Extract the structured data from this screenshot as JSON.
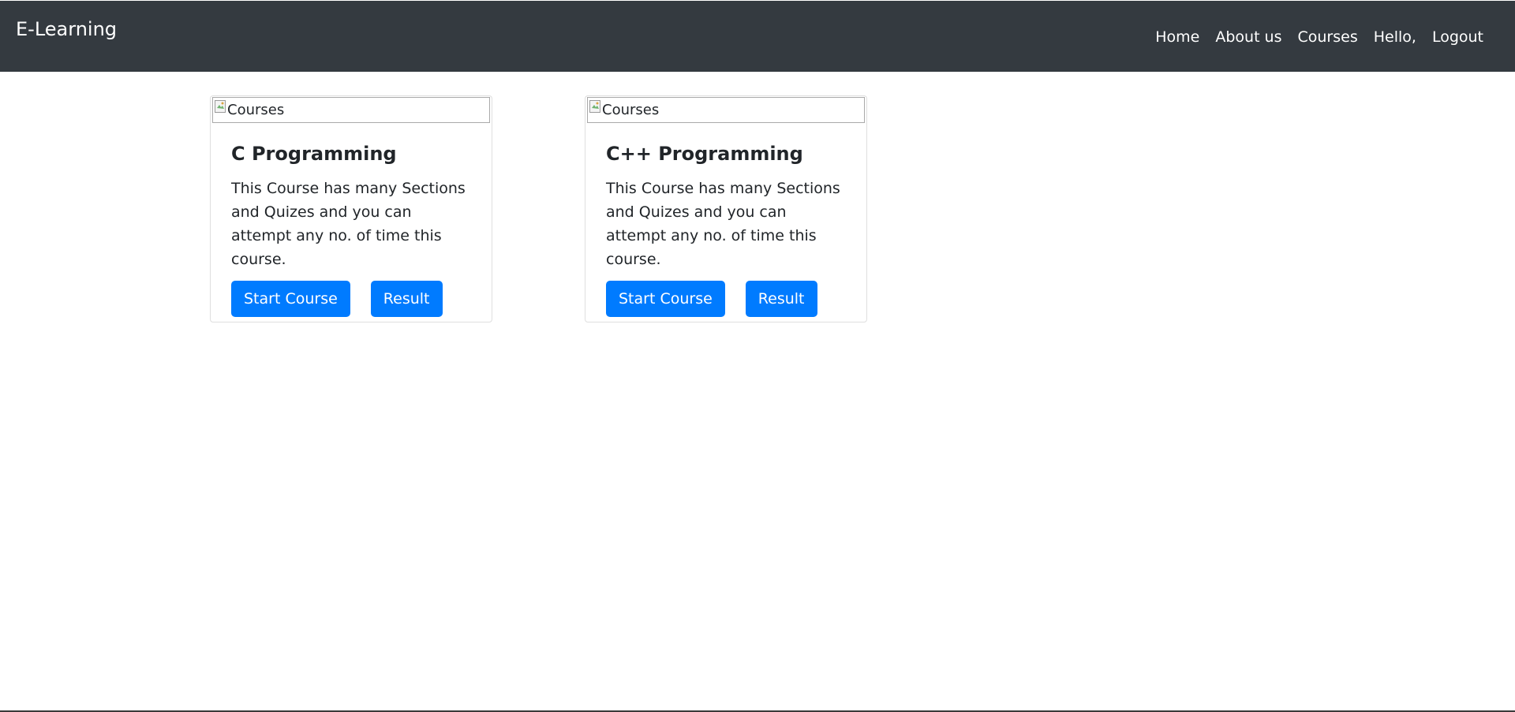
{
  "navbar": {
    "brand": "E-Learning",
    "links": [
      "Home",
      "About us",
      "Courses",
      "Hello,",
      "Logout"
    ]
  },
  "courses": [
    {
      "image_alt": "Courses",
      "title": "C Programming",
      "description": "This Course has many Sections and Quizes and you can attempt any no. of time this course.",
      "start_label": "Start Course",
      "result_label": "Result"
    },
    {
      "image_alt": "Courses",
      "title": "C++ Programming",
      "description": "This Course has many Sections and Quizes and you can attempt any no. of time this course.",
      "start_label": "Start Course",
      "result_label": "Result"
    }
  ],
  "colors": {
    "navbar_bg": "#343a40",
    "primary": "#007bff"
  }
}
